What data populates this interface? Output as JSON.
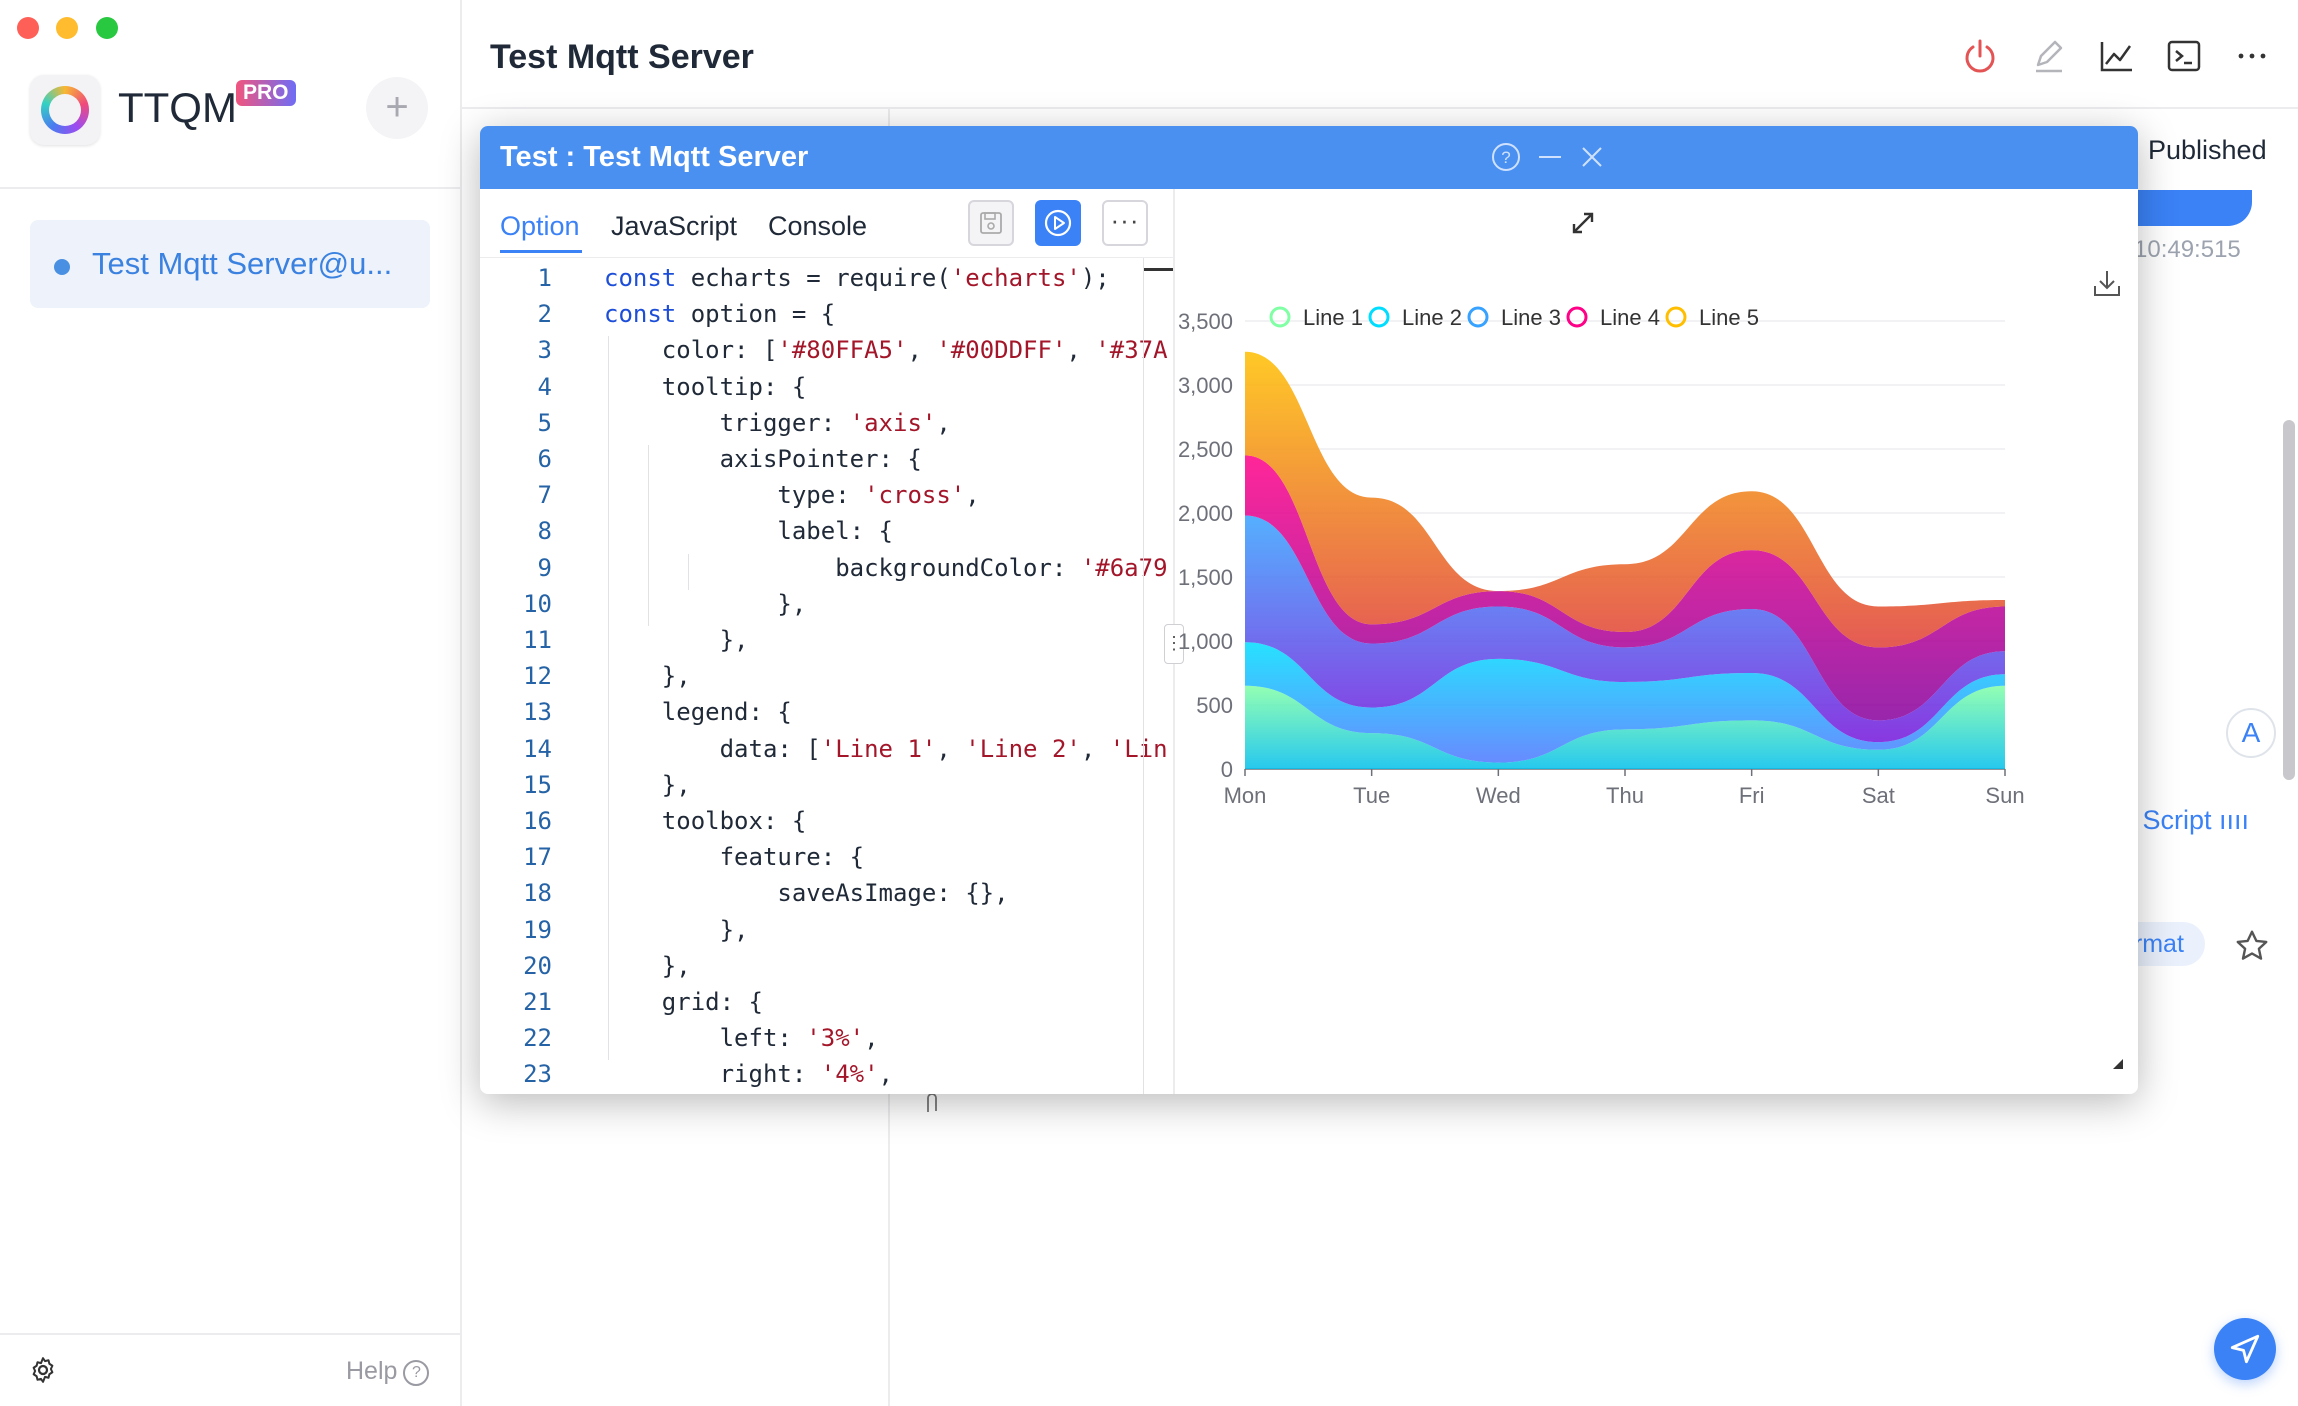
{
  "window_controls": [
    "close",
    "minimize",
    "zoom"
  ],
  "sidebar": {
    "app_name": "TTQM",
    "badge": "PRO",
    "connections": [
      {
        "label": "Test Mqtt Server@u...",
        "status_color": "#4a90e2"
      }
    ],
    "help_label": "Help"
  },
  "header": {
    "title": "Test Mqtt Server"
  },
  "background": {
    "published_label": "Published",
    "timestamp": "10:49:515",
    "script_label": "n Script ıııı",
    "format_label": "ormat",
    "avatar_letter": "A"
  },
  "dialog": {
    "title": "Test : Test Mqtt Server",
    "tabs": [
      {
        "label": "Option",
        "active": true
      },
      {
        "label": "JavaScript"
      },
      {
        "label": "Console"
      }
    ],
    "more_label": "···",
    "code_lines": [
      "const echarts = require('echarts');",
      "const option = {",
      "    color: ['#80FFA5', '#00DDFF', '#37A",
      "    tooltip: {",
      "        trigger: 'axis',",
      "        axisPointer: {",
      "            type: 'cross',",
      "            label: {",
      "                backgroundColor: '#6a79",
      "            },",
      "        },",
      "    },",
      "    legend: {",
      "        data: ['Line 1', 'Line 2', 'Lin",
      "    },",
      "    toolbox: {",
      "        feature: {",
      "            saveAsImage: {},",
      "        },",
      "    },",
      "    grid: {",
      "        left: '3%',",
      "        right: '4%',",
      "        bottom: '3%',"
    ]
  },
  "chart_data": {
    "type": "area",
    "stacked": true,
    "categories": [
      "Mon",
      "Tue",
      "Wed",
      "Thu",
      "Fri",
      "Sat",
      "Sun"
    ],
    "ylim": [
      0,
      3500
    ],
    "yticks": [
      "0",
      "500",
      "1,000",
      "1,500",
      "2,000",
      "2,500",
      "3,000",
      "3,500"
    ],
    "legend_position": "top-center",
    "grid": true,
    "series": [
      {
        "name": "Line 1",
        "color": "#80FFA5",
        "values": [
          650,
          280,
          50,
          310,
          380,
          150,
          650
        ]
      },
      {
        "name": "Line 2",
        "color": "#00DDFF",
        "values": [
          340,
          200,
          810,
          370,
          370,
          60,
          90
        ]
      },
      {
        "name": "Line 3",
        "color": "#37A2FF",
        "values": [
          990,
          500,
          410,
          270,
          500,
          170,
          180
        ]
      },
      {
        "name": "Line 4",
        "color": "#FF0087",
        "values": [
          470,
          150,
          120,
          120,
          460,
          570,
          350
        ]
      },
      {
        "name": "Line 5",
        "color": "#FFBF00",
        "values": [
          810,
          990,
          0,
          530,
          460,
          320,
          50
        ]
      }
    ]
  }
}
